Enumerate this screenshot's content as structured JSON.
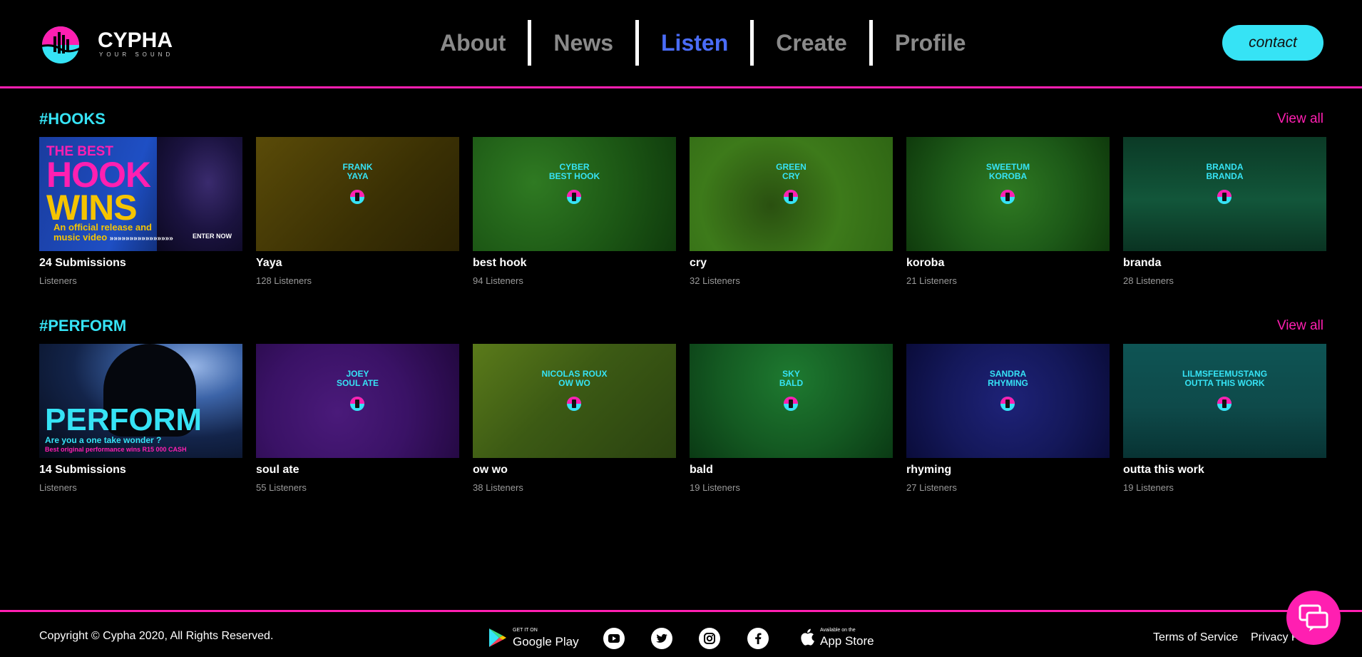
{
  "brand": {
    "name": "CYPHA",
    "tagline": "YOUR SOUND",
    "colors": {
      "accent_pink": "#ff1fb1",
      "accent_cyan": "#36e3f5",
      "active_nav": "#4a6cf7"
    }
  },
  "nav": {
    "items": [
      {
        "label": "About"
      },
      {
        "label": "News"
      },
      {
        "label": "Listen",
        "active": true
      },
      {
        "label": "Create"
      },
      {
        "label": "Profile"
      }
    ]
  },
  "contact_label": "contact",
  "sections": {
    "hooks": {
      "title": "#HOOKS",
      "view_all": "View all",
      "promo": {
        "line1": "THE BEST",
        "line2": "HOOK",
        "line3": "WINS",
        "line4": "An official release and",
        "line5": "music video",
        "arrows": "»»»»»»»»»»»»»»»»",
        "cta": "ENTER NOW",
        "title": "24 Submissions",
        "sub": "Listeners"
      },
      "cards": [
        {
          "label1": "FRANK",
          "label2": "YAYA",
          "title": "Yaya",
          "sub": "128 Listeners",
          "color": "#4a3f05"
        },
        {
          "label1": "CYBER",
          "label2": "BEST HOOK",
          "title": "best hook",
          "sub": "94 Listeners",
          "color": "#1f5e1a"
        },
        {
          "label1": "GREEN",
          "label2": "CRY",
          "title": "cry",
          "sub": "32 Listeners",
          "color": "#2f6614"
        },
        {
          "label1": "SWEETUM",
          "label2": "KOROBA",
          "title": "koroba",
          "sub": "21 Listeners",
          "color": "#1d5a18"
        },
        {
          "label1": "BRANDA",
          "label2": "BRANDA",
          "title": "branda",
          "sub": "28 Listeners",
          "color": "#0e4a30"
        }
      ]
    },
    "perform": {
      "title": "#PERFORM",
      "view_all": "View all",
      "promo": {
        "line1": "PERFORM",
        "line2": "Are you a one take wonder ?",
        "line3": "Best original performance wins R15 000 CASH",
        "title": "14 Submissions",
        "sub": "Listeners"
      },
      "cards": [
        {
          "label1": "JOEY",
          "label2": "SOUL ATE",
          "title": "soul ate",
          "sub": "55 Listeners",
          "color": "#3a1266"
        },
        {
          "label1": "NICOLAS ROUX",
          "label2": "OW WO",
          "title": "ow wo",
          "sub": "38 Listeners",
          "color": "#3c5a14"
        },
        {
          "label1": "SKY",
          "label2": "BALD",
          "title": "bald",
          "sub": "19 Listeners",
          "color": "#145a22"
        },
        {
          "label1": "SANDRA",
          "label2": "RHYMING",
          "title": "rhyming",
          "sub": "27 Listeners",
          "color": "#14185a"
        },
        {
          "label1": "LILMSFEEMUSTANG",
          "label2": "OUTTA THIS WORK",
          "title": "outta this work",
          "sub": "19 Listeners",
          "color": "#0e4a4a"
        }
      ]
    }
  },
  "footer": {
    "copyright": "Copyright © Cypha 2020, All Rights Reserved.",
    "google_play": {
      "small": "GET IT ON",
      "big": "Google Play"
    },
    "app_store": {
      "small": "Available on the",
      "big": "App Store"
    },
    "social_icons": [
      "youtube-icon",
      "twitter-icon",
      "instagram-icon",
      "facebook-icon"
    ],
    "terms": "Terms of Service",
    "privacy": "Privacy Policy"
  }
}
